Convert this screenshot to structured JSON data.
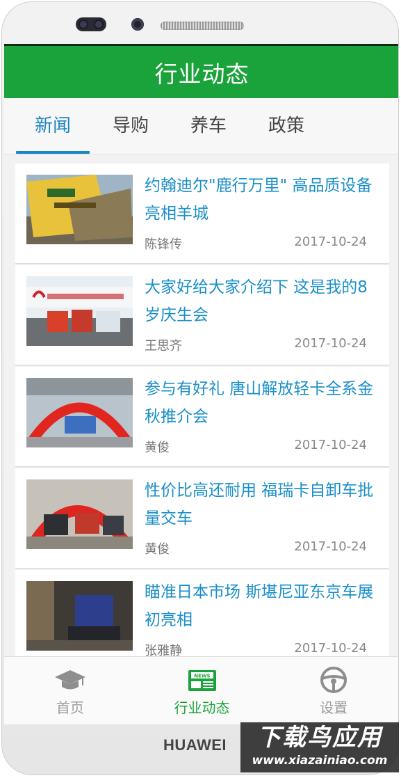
{
  "header": {
    "title": "行业动态"
  },
  "tabs": [
    {
      "label": "新闻",
      "active": true
    },
    {
      "label": "导购",
      "active": false
    },
    {
      "label": "养车",
      "active": false
    },
    {
      "label": "政策",
      "active": false
    }
  ],
  "articles": [
    {
      "title": "约翰迪尔\"鹿行万里\" 高品质设备亮相羊城",
      "author": "陈锋传",
      "date": "2017-10-24"
    },
    {
      "title": "大家好给大家介绍下 这是我的8岁庆生会",
      "author": "王思齐",
      "date": "2017-10-24"
    },
    {
      "title": "参与有好礼 唐山解放轻卡全系金秋推介会",
      "author": "黄俊",
      "date": "2017-10-24"
    },
    {
      "title": "性价比高还耐用 福瑞卡自卸车批量交车",
      "author": "黄俊",
      "date": "2017-10-24"
    },
    {
      "title": "瞄准日本市场 斯堪尼亚东京车展初亮相",
      "author": "张雅静",
      "date": "2017-10-24"
    }
  ],
  "bottom_nav": [
    {
      "label": "首页",
      "icon": "graduation-cap-icon",
      "active": false
    },
    {
      "label": "行业动态",
      "icon": "newspaper-icon",
      "active": true
    },
    {
      "label": "设置",
      "icon": "steering-wheel-icon",
      "active": false
    }
  ],
  "device": {
    "brand": "HUAWEI"
  },
  "watermark": {
    "line1": "下载鸟应用",
    "line2": "www.xiazainiao.com"
  },
  "colors": {
    "accent_green": "#1aa33a",
    "tab_blue": "#1d86c4",
    "title_blue": "#1a8fc9"
  }
}
